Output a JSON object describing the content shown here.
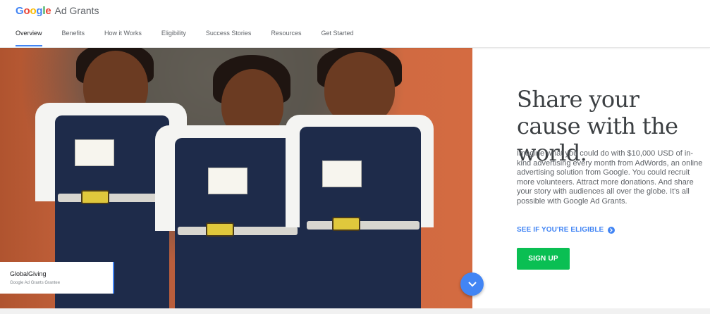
{
  "brand": {
    "logo_letters": [
      {
        "char": "G",
        "color": "#4285f4"
      },
      {
        "char": "o",
        "color": "#ea4335"
      },
      {
        "char": "o",
        "color": "#fbbc05"
      },
      {
        "char": "g",
        "color": "#4285f4"
      },
      {
        "char": "l",
        "color": "#34a853"
      },
      {
        "char": "e",
        "color": "#ea4335"
      }
    ],
    "product": "Ad Grants"
  },
  "nav": {
    "items": [
      {
        "label": "Overview",
        "active": true
      },
      {
        "label": "Benefits",
        "active": false
      },
      {
        "label": "How it Works",
        "active": false
      },
      {
        "label": "Eligibility",
        "active": false
      },
      {
        "label": "Success Stories",
        "active": false
      },
      {
        "label": "Resources",
        "active": false
      },
      {
        "label": "Get Started",
        "active": false
      }
    ]
  },
  "hero": {
    "caption": {
      "name": "GlobalGiving",
      "subtitle": "Google Ad Grants Grantee"
    },
    "scroll_icon": "chevron-down-icon"
  },
  "panel": {
    "headline": "Share your cause with the world.",
    "body": "Imagine what you could do with $10,000 USD of in-kind advertising every month from AdWords, an online advertising solution from Google. You could recruit more volunteers. Attract more donations. And share your story with audiences all over the globe. It's all possible with Google Ad Grants.",
    "eligible_link": "SEE IF YOU'RE ELIGIBLE",
    "eligible_icon": "arrow-circle-right-icon",
    "signup_label": "SIGN UP"
  },
  "colors": {
    "accent_blue": "#4285f4",
    "signup_green": "#0abf53"
  }
}
